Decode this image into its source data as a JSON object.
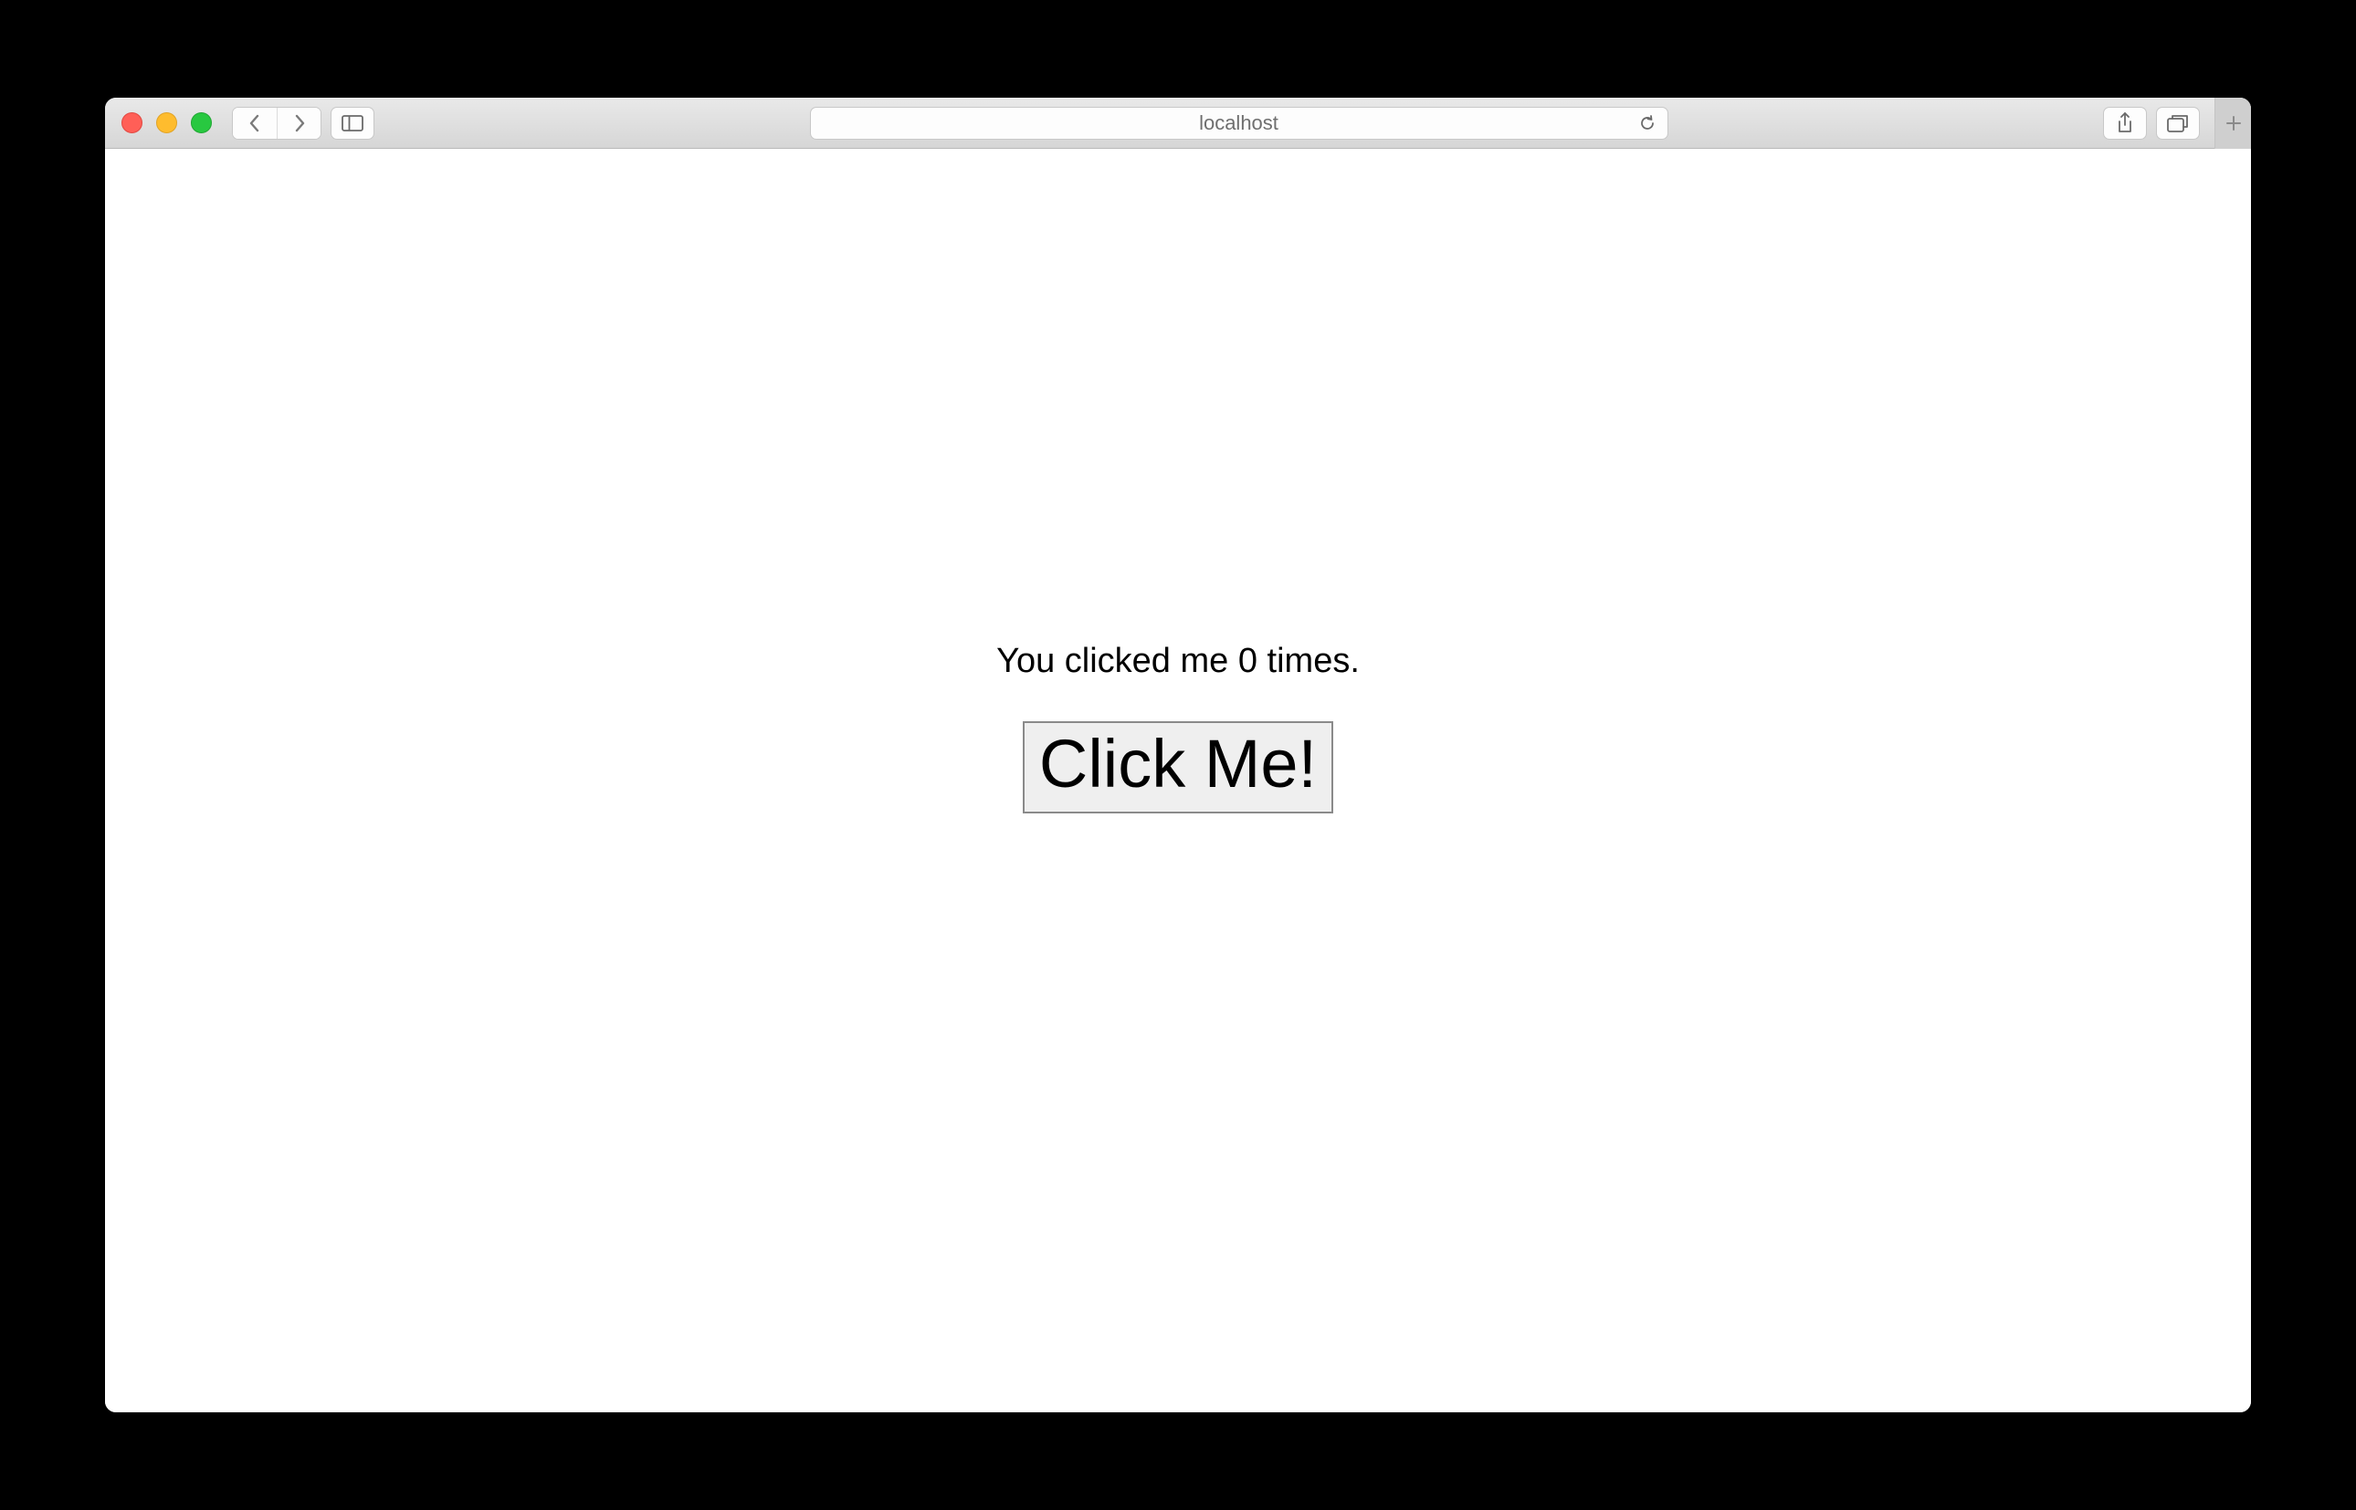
{
  "address_bar": {
    "url_text": "localhost"
  },
  "page": {
    "click_count_text": "You clicked me 0 times.",
    "button_label": "Click Me!"
  }
}
